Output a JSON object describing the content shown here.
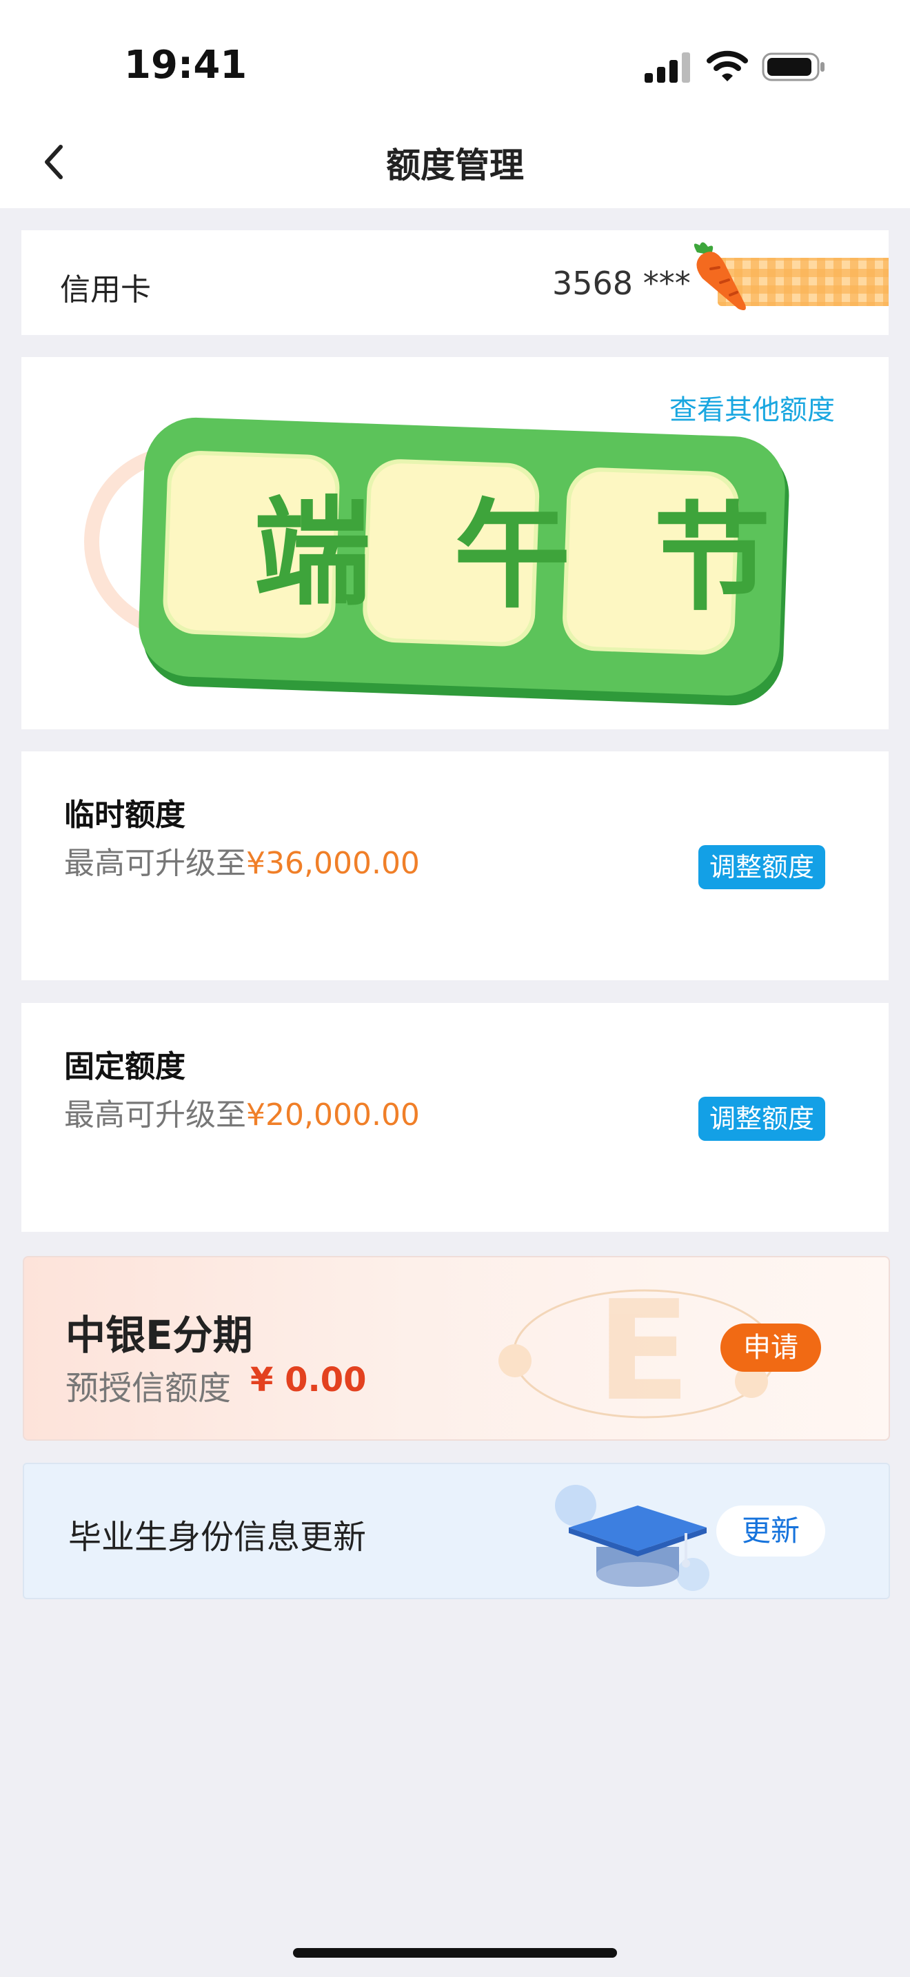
{
  "status_bar": {
    "time": "19:41"
  },
  "nav": {
    "title": "额度管理"
  },
  "account": {
    "label": "信用卡",
    "card_number": "3568 ***"
  },
  "quota_card": {
    "view_other_label": "查看其他额度",
    "currency_symbol": "¥",
    "festival_badge": [
      "端",
      "午",
      "节"
    ]
  },
  "temporary_quota": {
    "title": "临时额度",
    "sub_prefix": "最高可升级至",
    "max_amount": "¥36,000.00",
    "button_label": "调整额度"
  },
  "fixed_quota": {
    "title": "固定额度",
    "sub_prefix": "最高可升级至",
    "max_amount": "¥20,000.00",
    "button_label": "调整额度"
  },
  "e_installment": {
    "title": "中银E分期",
    "sub_label": "预授信额度",
    "amount": "¥ 0.00",
    "button_label": "申请"
  },
  "graduate_update": {
    "title": "毕业生身份信息更新",
    "button_label": "更新"
  },
  "colors": {
    "accent_blue": "#13a0e6",
    "amount_orange": "#f07f28",
    "apply_orange": "#f16a14",
    "badge_green": "#4bbd4a"
  }
}
